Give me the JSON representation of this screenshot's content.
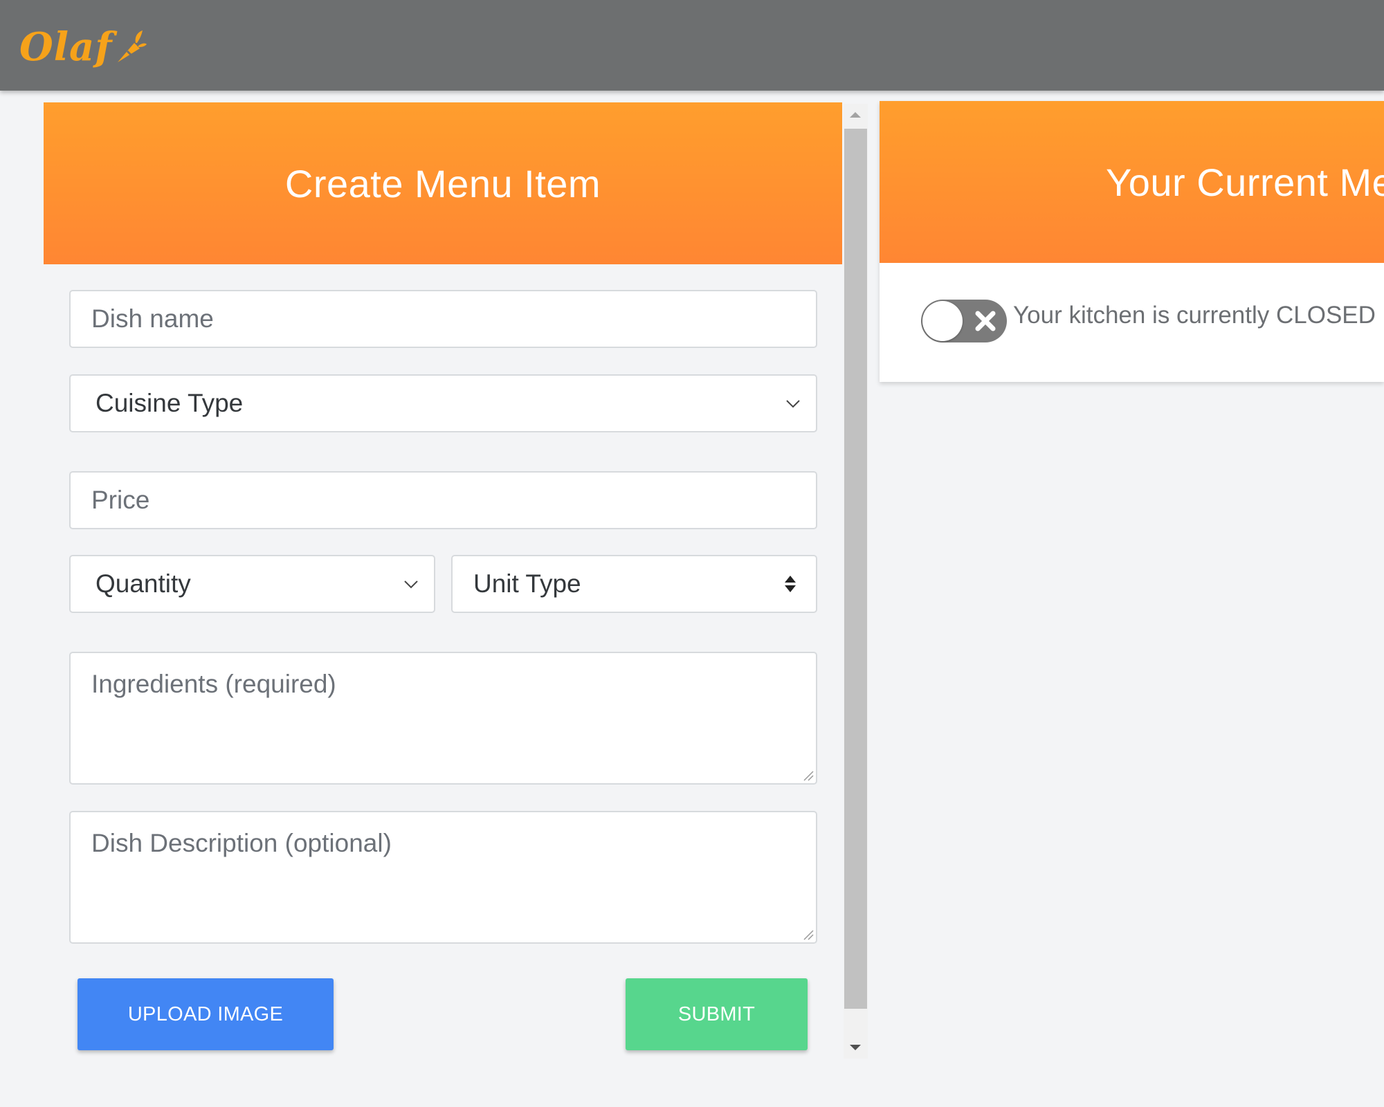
{
  "app": {
    "logo_text": "Olaf",
    "colors": {
      "header_bar": "#6d6f70",
      "brand_orange": "#ff8e30",
      "upload_blue": "#4286f4",
      "submit_green": "#57d68d"
    }
  },
  "create_card": {
    "title": "Create Menu Item",
    "dish_name_placeholder": "Dish name",
    "cuisine_select": "Cuisine Type",
    "price_placeholder": "Price",
    "quantity_select": "Quantity",
    "unit_select": "Unit Type",
    "ingredients_placeholder": "Ingredients (required)",
    "description_placeholder": "Dish Description (optional)",
    "upload_label": "UPLOAD IMAGE",
    "submit_label": "SUBMIT"
  },
  "menu_card": {
    "title": "Your Current Me",
    "kitchen_status": "Your kitchen is currently CLOSED",
    "toggle_state": "off"
  }
}
